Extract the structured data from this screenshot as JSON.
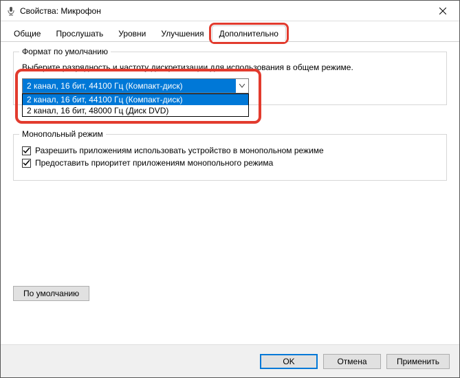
{
  "window": {
    "title": "Свойства: Микрофон"
  },
  "tabs": {
    "items": [
      "Общие",
      "Прослушать",
      "Уровни",
      "Улучшения",
      "Дополнительно"
    ],
    "active": 4
  },
  "format": {
    "legend": "Формат по умолчанию",
    "desc": "Выберите разрядность и частоту дискретизации для использования в общем режиме.",
    "selected": "2 канал, 16 бит, 44100 Гц (Компакт-диск)",
    "options": [
      "2 канал, 16 бит, 44100 Гц (Компакт-диск)",
      "2 канал, 16 бит, 48000 Гц (Диск DVD)"
    ]
  },
  "exclusive": {
    "legend": "Монопольный режим",
    "allow": "Разрешить приложениям использовать устройство в монопольном режиме",
    "priority": "Предоставить приоритет приложениям монопольного режима"
  },
  "buttons": {
    "defaults": "По умолчанию",
    "ok": "OK",
    "cancel": "Отмена",
    "apply": "Применить"
  }
}
